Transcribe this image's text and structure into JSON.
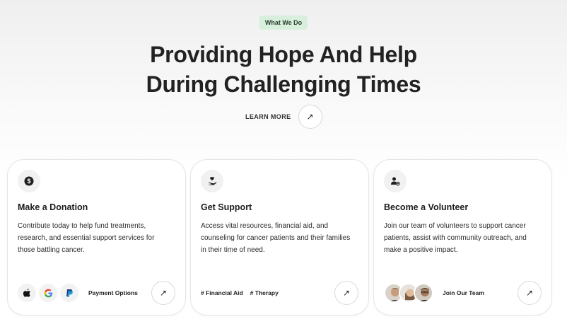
{
  "badge": "What We Do",
  "headline": {
    "line1": "Providing Hope And Help",
    "line2": "During Challenging Times"
  },
  "learn_more": "LEARN MORE",
  "cards": [
    {
      "icon": "dollar-icon",
      "title": "Make a Donation",
      "desc": "Contribute today to help fund treatments, research, and essential support services for those battling cancer.",
      "footer_label": "Payment Options",
      "payment_icons": [
        "apple-icon",
        "google-icon",
        "paypal-icon"
      ]
    },
    {
      "icon": "hand-heart-icon",
      "title": "Get Support",
      "desc": "Access vital resources, financial aid, and counseling for cancer patients and their families in their time of need.",
      "tags": [
        "# Financial Aid",
        "# Therapy"
      ]
    },
    {
      "icon": "user-add-icon",
      "title": "Become a Volunteer",
      "desc": "Join our team of volunteers to support cancer patients, assist with community outreach, and make a positive impact.",
      "footer_label": "Join Our Team"
    }
  ],
  "colors": {
    "badge_bg": "#d8efdd",
    "text": "#1d1d1d"
  }
}
